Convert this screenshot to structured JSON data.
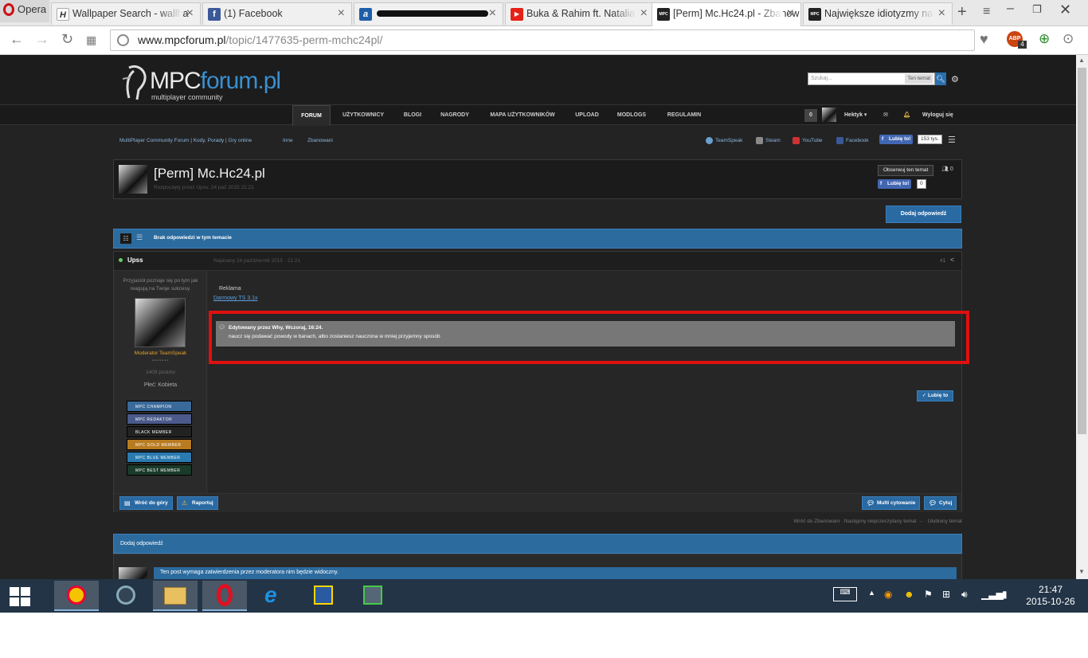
{
  "browser": {
    "opera_label": "Opera",
    "tabs": [
      {
        "title": "Wallpaper Search - wallha",
        "fav": "H",
        "fav_color": "#ffffff",
        "fav_text": "#333333"
      },
      {
        "title": "(1) Facebook",
        "fav": "f",
        "fav_color": "#3b5998",
        "fav_text": "#ffffff"
      },
      {
        "title": "",
        "fav": "a",
        "fav_color": "#1f5ea8",
        "fav_text": "#ffffff"
      },
      {
        "title": "Buka & Rahim ft. Natalia",
        "fav": "▶",
        "fav_color": "#e62117",
        "fav_text": "#ffffff"
      },
      {
        "title": "[Perm] Mc.Hc24.pl - Zbanow",
        "fav": "MPC",
        "fav_color": "#222222",
        "fav_text": "#ffffff"
      },
      {
        "title": "Największe idiotyzmy na",
        "fav": "MPC",
        "fav_color": "#222222",
        "fav_text": "#ffffff"
      }
    ],
    "url_domain": "www.mpcforum.pl",
    "url_path": "/topic/1477635-perm-mchc24pl/",
    "abp_badge": "4"
  },
  "site": {
    "logo_main": "MPC",
    "logo_accent": "forum.pl",
    "logo_sub": "multiplayer community",
    "search_placeholder": "Szukaj...",
    "search_scope": "Ten temat",
    "nav": [
      "FORUM",
      "UŻYTKOWNICY",
      "BLOGI",
      "NAGRODY",
      "MAPA UŻYTKOWNIKÓW",
      "UPLOAD",
      "MODLOGS",
      "REGULAMIN"
    ],
    "user": {
      "notif_count": "0",
      "name": "Hektyk",
      "logout": "Wyloguj się"
    },
    "breadcrumbs": [
      "MultiPlayer Community Forum | Kody, Porady | Gry online",
      "Inne",
      "Zbanowani"
    ],
    "social": [
      "TeamSpeak",
      "Steam",
      "YouTube",
      "Facebook"
    ],
    "like_label": "Lubię to!",
    "like_count": "153 tys."
  },
  "topic": {
    "title": "[Perm] Mc.Hc24.pl",
    "started": "Rozpoczęty przez Upss, 24 paź 2015 21:21",
    "follow": "Obserwuj ten temat",
    "followers": "0",
    "fb_like": "Lubię to!",
    "fb_count": "0",
    "reply_button": "Dodaj odpowiedź",
    "no_replies": "Brak odpowiedzi w tym temacie"
  },
  "post": {
    "author": "Upss",
    "date": "Napisany 24 październik 2015 - 21:21",
    "number": "#1",
    "quote": "Przyjaciół poznaje się po tym jak reagują na Twoje sukcesy.",
    "rank": "Moderator TeamSpeak",
    "posts": "1409 postów",
    "gender": "Płeć: Kobieta",
    "badges": [
      "MPC CHAMPION",
      "MPC REDAKTOR",
      "BLACK MEMBER",
      "MPC GOLD MEMBER",
      "MPC BLUE MEMBER",
      "MPC BEST MEMBER"
    ],
    "badge_colors": [
      "#3a6a9a",
      "#4a5a8a",
      "#222222",
      "#b87b20",
      "#2a7ab0",
      "#1a3a2a"
    ],
    "ad_label": "Reklama",
    "ad_link": "Darmowy TS 3.1x",
    "edited_by": "Edytowany przez Why, Wczoraj, 16:24.",
    "edit_reason": "naucz się podawać powody w banach, albo zostaniesz nauczona w mniej przyjemny sposób",
    "like": "Lubię to",
    "back_top": "Wróć do góry",
    "report": "Raportuj",
    "multiquote": "Multi cytowanie",
    "quote_btn": "Cytuj"
  },
  "footer_links": "Wróć do Zbanowani · Następny nieprzeczytany temat → · Ulubiony temat",
  "reply": {
    "header": "Dodaj odpowiedź",
    "notice": "Ten post wymaga zatwierdzenia przez moderatora nim będzie widoczny."
  },
  "taskbar": {
    "time": "21:47",
    "date": "2015-10-26"
  }
}
